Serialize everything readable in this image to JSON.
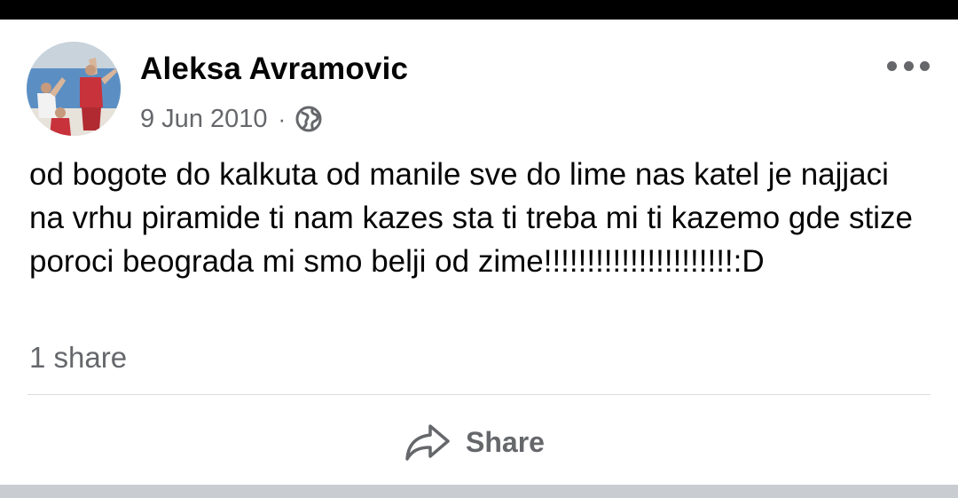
{
  "post": {
    "author_name": "Aleksa Avramovic",
    "date": "9 Jun 2010",
    "separator": "·",
    "privacy_icon": "globe-icon",
    "options_icon": "more-options-icon",
    "text": "od bogote do kalkuta od manile sve do lime nas katel je najjaci na vrhu piramide ti nam kazes sta ti treba mi ti kazemo gde stize poroci beograda mi smo belji od zime!!!!!!!!!!!!!!!!!!!!!!:D",
    "share_count": "1 share"
  },
  "actions": {
    "share_label": "Share",
    "share_icon": "share-arrow-icon"
  },
  "colors": {
    "primary_text": "#050505",
    "secondary_text": "#65676b",
    "divider": "#dadde1",
    "top_bar": "#000000",
    "bottom_strip": "#c9ccd1"
  }
}
